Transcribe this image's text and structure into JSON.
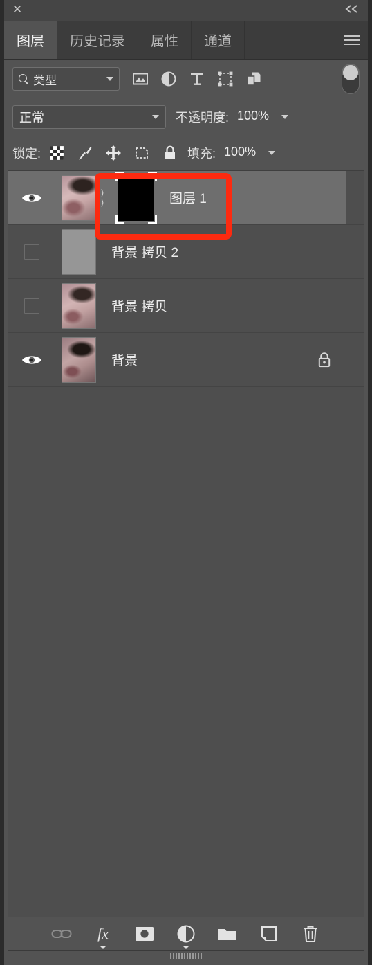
{
  "titlebar": {
    "close": "✕",
    "collapse": "«"
  },
  "tabs": [
    {
      "label": "图层",
      "active": true
    },
    {
      "label": "历史记录",
      "active": false
    },
    {
      "label": "属性",
      "active": false
    },
    {
      "label": "通道",
      "active": false
    }
  ],
  "menu": {
    "name": "panel-menu-icon"
  },
  "filter": {
    "type_label": "类型",
    "icons": [
      "pixel-layer-filter-icon",
      "adjustment-layer-filter-icon",
      "text-layer-filter-icon",
      "shape-layer-filter-icon",
      "smart-object-filter-icon"
    ],
    "toggle_state": "on"
  },
  "blend": {
    "mode": "正常",
    "opacity_label": "不透明度:",
    "opacity_value": "100%"
  },
  "lock": {
    "label": "锁定:",
    "icons": [
      "lock-transparency-icon",
      "lock-pixels-icon",
      "lock-position-icon",
      "lock-artboard-icon",
      "lock-all-icon"
    ],
    "fill_label": "填充:",
    "fill_value": "100%"
  },
  "layers": [
    {
      "name": "图层 1",
      "visible": true,
      "selected": true,
      "thumb": "face1",
      "has_mask": true,
      "locked": false
    },
    {
      "name": "背景 拷贝 2",
      "visible": false,
      "selected": false,
      "thumb": "flat",
      "has_mask": false,
      "locked": false
    },
    {
      "name": "背景 拷贝",
      "visible": false,
      "selected": false,
      "thumb": "face2",
      "has_mask": false,
      "locked": false
    },
    {
      "name": "背景",
      "visible": true,
      "selected": false,
      "thumb": "face3",
      "has_mask": false,
      "locked": true
    }
  ],
  "bottom_toolbar": [
    "link-layers-icon",
    "fx-layer-style-icon",
    "add-mask-icon",
    "new-adjustment-layer-icon",
    "new-group-icon",
    "new-layer-icon",
    "delete-layer-icon"
  ],
  "annotation": {
    "color": "#fc2a10",
    "target": "图层 1"
  },
  "colors": {
    "panel_bg": "#535353",
    "tab_bg": "#3c3c3c",
    "list_bg": "#4e4e4e",
    "selected_row": "#6e6e6e",
    "accent_annotation": "#fc2a10",
    "text": "#ececec"
  }
}
